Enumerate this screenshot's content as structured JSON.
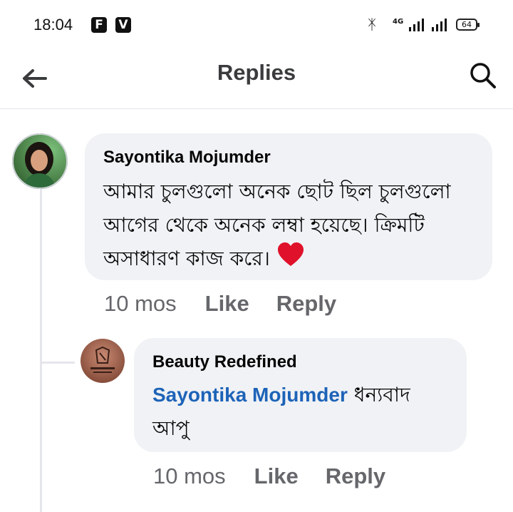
{
  "status_bar": {
    "time": "18:04",
    "app_icons": [
      "F",
      "V"
    ],
    "network": "4G",
    "battery": "64"
  },
  "header": {
    "title": "Replies"
  },
  "comment": {
    "author": "Sayontika Mojumder",
    "text": "আমার চুলগুলো অনেক ছোট ছিল চুলগুলো আগের থেকে অনেক লম্বা হয়েছে। ক্রিমটি অসাধারণ কাজ করে।",
    "reaction": "heart",
    "time": "10 mos",
    "like_label": "Like",
    "reply_label": "Reply"
  },
  "reply": {
    "author": "Beauty Redefined",
    "mention": "Sayontika Mojumder",
    "text": "ধন্যবাদ আপু",
    "time": "10 mos",
    "like_label": "Like",
    "reply_label": "Reply"
  }
}
